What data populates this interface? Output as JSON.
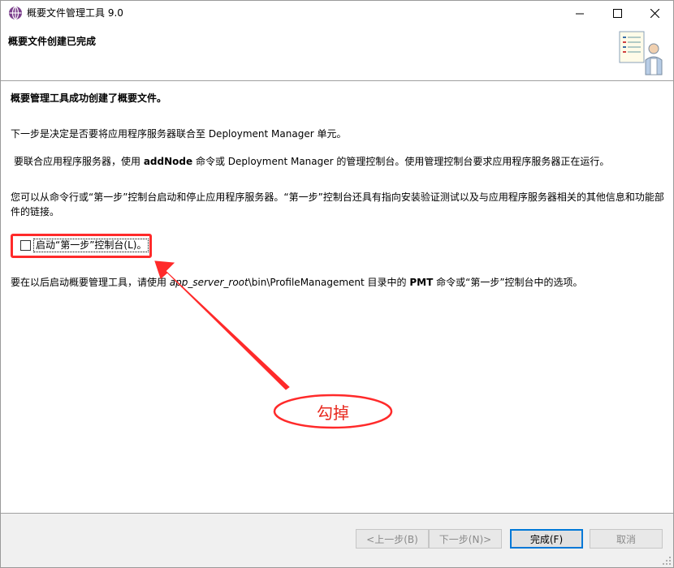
{
  "window": {
    "title": "概要文件管理工具 9.0",
    "controls": {
      "minimize": "—",
      "maximize": "☐",
      "close": "✕"
    }
  },
  "banner": {
    "title": "概要文件创建已完成",
    "icon": "wizard-checklist-person-icon"
  },
  "content": {
    "p1": "概要管理工具成功创建了概要文件。",
    "p2": "下一步是决定是否要将应用程序服务器联合至 Deployment Manager 单元。",
    "p3": {
      "a": "要联合应用程序服务器，使用 ",
      "b": "addNode",
      "c": " 命令或 Deployment Manager 的管理控制台。使用管理控制台要求应用程序服务器正在运行。"
    },
    "p4": "您可以从命令行或“第一步”控制台启动和停止应用程序服务器。“第一步”控制台还具有指向安装验证测试以及与应用程序服务器相关的其他信息和功能部件的链接。",
    "checkbox": {
      "label": "启动“第一步”控制台(L)。",
      "checked": false
    },
    "p5": {
      "a": "要在以后启动概要管理工具，请使用 ",
      "b": "app_server_root",
      "c": "\\bin\\ProfileManagement 目录中的 ",
      "d": "PMT",
      "e": " 命令或“第一步”控制台中的选项。"
    }
  },
  "annotation": {
    "text": "勾掉",
    "color": "#e8281e"
  },
  "footer": {
    "back": "<上一步(B)",
    "next": "下一步(N)>",
    "finish": "完成(F)",
    "cancel": "取消"
  },
  "colors": {
    "accent": "#0078d7",
    "annotation": "#ff2a2a",
    "app_icon": "#7b3f8c"
  }
}
